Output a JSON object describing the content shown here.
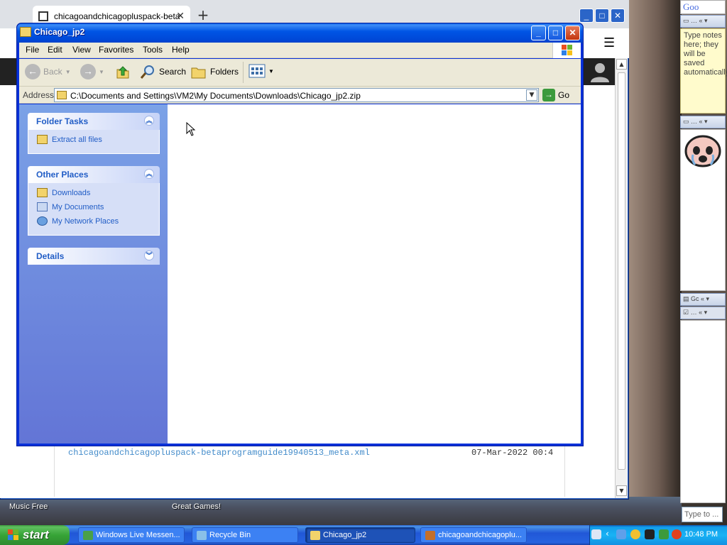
{
  "desktop": {
    "labels": [
      "Music Free",
      "Great Games!"
    ]
  },
  "browser": {
    "tab_title": "chicagoandchicagopluspack-beta",
    "new_tab": "+",
    "menu_icon": "☰",
    "site": {
      "file_name": "chicagoandchicagopluspack-betaprogramguide19940513_meta.xml",
      "file_date": "07-Mar-2022 00:4"
    }
  },
  "explorer": {
    "title": "Chicago_jp2",
    "menu": [
      "File",
      "Edit",
      "View",
      "Favorites",
      "Tools",
      "Help"
    ],
    "toolbar": {
      "back": "Back",
      "search": "Search",
      "folders": "Folders"
    },
    "address": {
      "label": "Address",
      "path": "C:\\Documents and Settings\\VM2\\My Documents\\Downloads\\Chicago_jp2.zip",
      "go": "Go"
    },
    "panels": {
      "folder_tasks": {
        "title": "Folder Tasks",
        "items": [
          "Extract all files"
        ]
      },
      "other_places": {
        "title": "Other Places",
        "items": [
          "Downloads",
          "My Documents",
          "My Network Places"
        ]
      },
      "details": {
        "title": "Details"
      }
    }
  },
  "sidebar": {
    "google": "Goo",
    "note_text": "Type notes here; they will be saved automatically.",
    "gadget_label": "Gc",
    "search_placeholder": "Type to ..."
  },
  "taskbar": {
    "start": "start",
    "tasks": [
      {
        "label": "Windows Live Messen...",
        "active": false
      },
      {
        "label": "Recycle Bin",
        "active": false
      },
      {
        "label": "Chicago_jp2",
        "active": true
      },
      {
        "label": "chicagoandchicagoplu...",
        "active": false
      }
    ],
    "clock": "10:48 PM"
  }
}
